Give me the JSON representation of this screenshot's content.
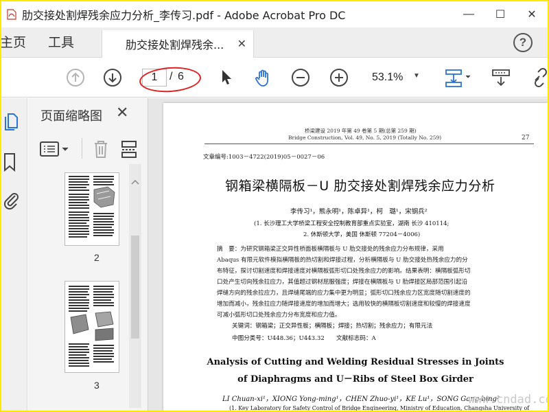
{
  "window": {
    "title": "肋交接处割焊残余应力分析_李传习.pdf - Adobe Acrobat Pro DC",
    "minimize_symbol": "—",
    "maximize_symbol": "☐",
    "close_symbol": "✕"
  },
  "tabs": {
    "home": "主页",
    "tools": "工具",
    "document": "肋交接处割焊残余...",
    "close_symbol": "✕",
    "help_symbol": "?"
  },
  "toolbar": {
    "page_current": "1",
    "page_separator": "/",
    "page_total": "6",
    "zoom": "53.1%",
    "zoom_caret": "▼"
  },
  "panel": {
    "title": "页面缩略图",
    "close_symbol": "✕",
    "thumbs": [
      {
        "label": "2"
      },
      {
        "label": "3"
      }
    ],
    "collapse_symbol": "◀"
  },
  "document": {
    "journal_cn": "桥梁建设  2019 年第 49 卷第 5 期(总第 259 期)",
    "journal_en": "Bridge Construction, Vol. 49, No. 5, 2019 (Totally No. 259)",
    "page_number": "27",
    "article_no": "文章编号:1003－4722(2019)05－0027－06",
    "title_cn": "钢箱梁横隔板－U 肋交接处割焊残余应力分析",
    "authors_cn": "李传习¹，熊永明¹，陈卓异¹，柯　璐¹，宋钢兵²",
    "affiliation_1": "(1. 长沙理工大学桥梁工程安全控制教育部重点实验室，湖南 长沙 410114;",
    "affiliation_2": "2. 休斯顿大学，美国 休斯顿 77204－4006)",
    "abstract_lines": [
      "摘　要：为研究钢箱梁正交异性桥面板横隔板与 U 肋交接处的残余应力分布规律，采用",
      "Abaqus 有限元软件模拟横隔板的热切割和焊接过程，分析横隔板与 U 肋交接处热残余应力的分",
      "布特征，探讨切割速度和焊接速度对横隔板弧形切口处残余应力的影响。结果表明：横隔板弧形切",
      "口处产生切向残余拉应力，其值超过钢材屈服强度；焊接在横隔板与 U 肋焊接区局部范围引起沿",
      "焊缝方向的残余拉应力，且焊缝尾端的应力集中更为明显；弧形切口残余应力区宽度随切割速度的",
      "增加而减小，残余拉应力随焊接速度的增加而增大；选用较快的横隔板切割速度和较慢的焊接速度",
      "可减小弧形切口处残余应力分布宽度和应力值。"
    ],
    "keywords": "关键词：钢箱梁；正交异性板；横隔板；焊接；热切割；残余应力；有限元法",
    "classification": "中图分类号：U448.36；U443.32　　文献标志码：A",
    "title_en_1": "Analysis of Cutting and Welding Residual Stresses in Joints",
    "title_en_2": "of Diaphragms and U－Ribs of Steel Box Girder",
    "authors_en": "LI Chuan-xi¹，XIONG Yong-ming¹，CHEN Zhuo-yi¹，KE Lu¹，SONG Gang-bing²",
    "affiliation_en": "(1. Key Laboratory for Safety Control of Bridge Engineering, Ministry of Education, Changsha University of"
  },
  "watermark": "www.cndad.com",
  "colors": {
    "frame": "#ffe900",
    "annotation_red": "#e02020",
    "icon_blue": "#2a73d3"
  }
}
